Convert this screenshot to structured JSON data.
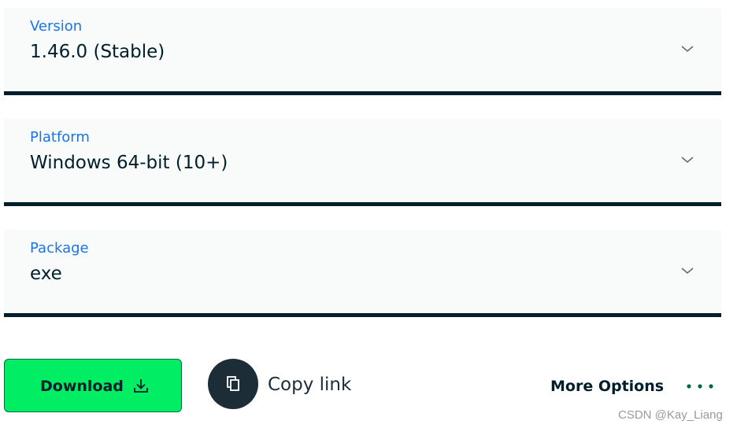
{
  "selects": {
    "version": {
      "label": "Version",
      "value": "1.46.0 (Stable)"
    },
    "platform": {
      "label": "Platform",
      "value": "Windows 64-bit (10+)"
    },
    "package": {
      "label": "Package",
      "value": "exe"
    }
  },
  "actions": {
    "download_label": "Download",
    "copy_link_label": "Copy link",
    "more_options_label": "More Options"
  },
  "watermark": "CSDN @Kay_Liang",
  "icons": {
    "chevron": "chevron-down-icon",
    "download": "download-icon",
    "copy": "copy-icon",
    "more": "ellipsis-icon"
  },
  "colors": {
    "label_blue": "#1a73e8",
    "text_dark": "#001e2b",
    "download_green": "#00ed64",
    "dots_green": "#00684a",
    "copy_circle": "#1c2d38"
  }
}
